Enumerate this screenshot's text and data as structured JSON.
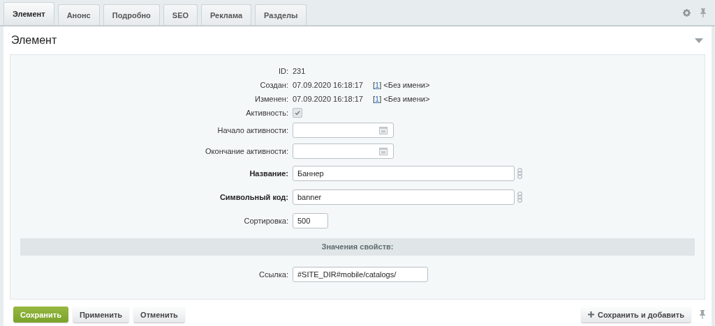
{
  "tabs": [
    {
      "label": "Элемент",
      "selected": true
    },
    {
      "label": "Анонс",
      "selected": false
    },
    {
      "label": "Подробно",
      "selected": false
    },
    {
      "label": "SEO",
      "selected": false
    },
    {
      "label": "Реклама",
      "selected": false
    },
    {
      "label": "Разделы",
      "selected": false
    }
  ],
  "section": {
    "title": "Элемент",
    "expanded": true
  },
  "fields": [
    {
      "kind": "text",
      "label": "ID:",
      "value": "231"
    },
    {
      "kind": "meta",
      "label": "Создан:",
      "value": "07.09.2020 16:18:17",
      "author": {
        "prefix": "[",
        "link": "1",
        "suffix": "] <Без имени>"
      }
    },
    {
      "kind": "meta",
      "label": "Изменен:",
      "value": "07.09.2020 16:18:17",
      "author": {
        "prefix": "[",
        "link": "1",
        "suffix": "] <Без имени>"
      }
    },
    {
      "kind": "checkbox",
      "label": "Активность:",
      "checked": true
    },
    {
      "kind": "date",
      "label": "Начало активности:"
    },
    {
      "kind": "date",
      "label": "Окончание активности:"
    },
    {
      "kind": "input",
      "label": "Название:",
      "value": "Баннер",
      "required": true,
      "translit": true
    },
    {
      "kind": "input",
      "label": "Символьный код:",
      "value": "banner",
      "required": true,
      "translit": true
    },
    {
      "kind": "input",
      "label": "Сортировка:",
      "value": "500",
      "required": false,
      "translit": false
    }
  ],
  "properties": {
    "title": "Значения свойств:",
    "fields": [
      {
        "kind": "input",
        "label": "Ссылка:",
        "value": "#SITE_DIR#mobile/catalogs/",
        "required": false,
        "translit": false
      }
    ]
  },
  "buttons": [
    {
      "label": "Сохранить",
      "kind": "primary"
    },
    {
      "label": "Применить",
      "kind": "default"
    },
    {
      "label": "Отменить",
      "kind": "default"
    }
  ],
  "extra_button": {
    "label": "Сохранить и добавить"
  }
}
